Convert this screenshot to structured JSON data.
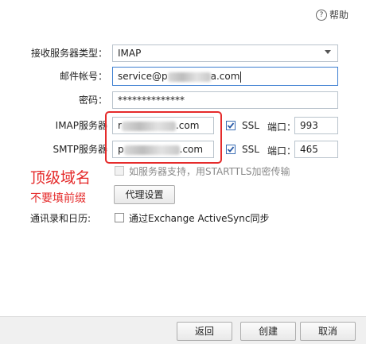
{
  "help": {
    "icon": "question-circle-icon",
    "label": "帮助"
  },
  "form": {
    "server_type": {
      "label": "接收服务器类型：",
      "value": "IMAP"
    },
    "email": {
      "label": "邮件帐号：",
      "prefix": "service@p",
      "suffix": "a.com"
    },
    "password": {
      "label": "密码：",
      "value": "**************"
    },
    "imap": {
      "label": "IMAP服务器",
      "prefix": "r",
      "suffix": ".com",
      "ssl_label": "SSL",
      "port_label": "端口：",
      "port": "993",
      "ssl_checked": true
    },
    "smtp": {
      "label": "SMTP服务器",
      "prefix": "p",
      "suffix": ".com",
      "ssl_label": "SSL",
      "port_label": "端口：",
      "port": "465",
      "ssl_checked": true
    },
    "starttls_label": "如服务器支持，用STARTTLS加密传输",
    "proxy_button": "代理设置",
    "contacts": {
      "label": "通讯录和日历:",
      "option": "通过Exchange ActiveSync同步"
    }
  },
  "annotation": {
    "line1": "顶级域名",
    "line2": "不要填前缀",
    "color": "#e52b2b"
  },
  "footer": {
    "back": "返回",
    "create": "创建",
    "cancel": "取消"
  }
}
